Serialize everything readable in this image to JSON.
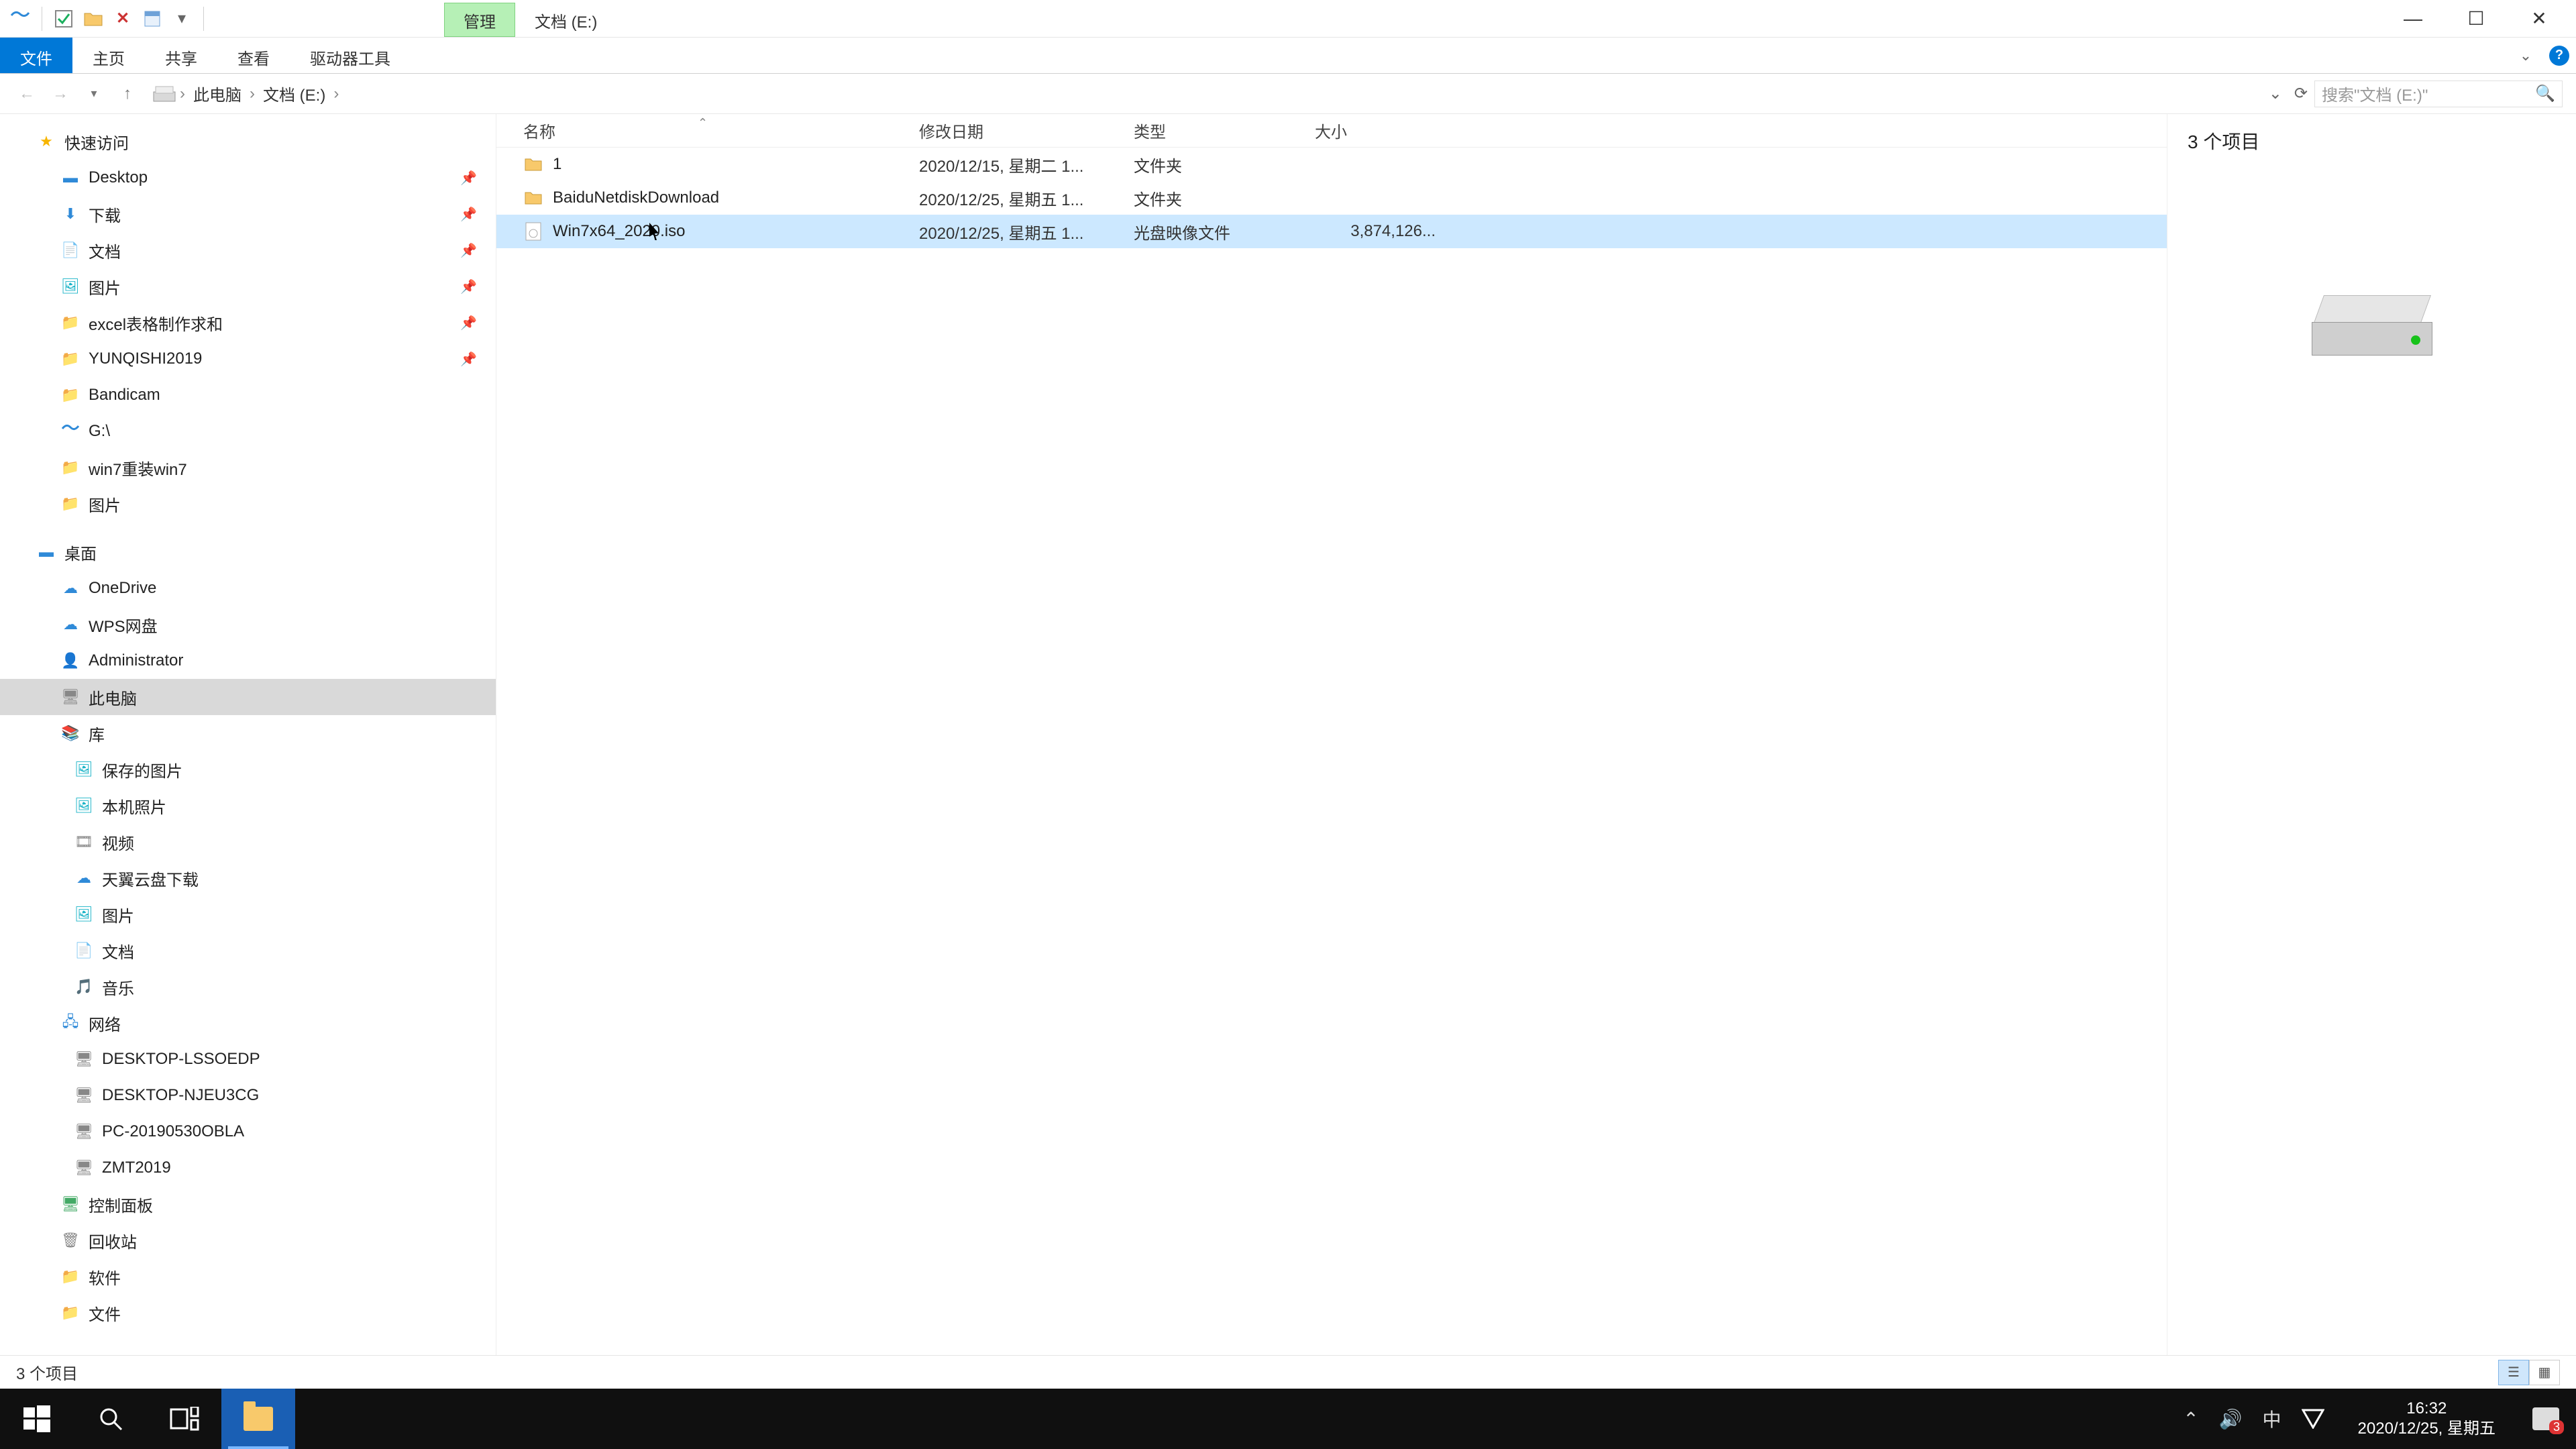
{
  "title_tab_context": "管理",
  "title_tab_location": "文档 (E:)",
  "ribbon": {
    "file": "文件",
    "home": "主页",
    "share": "共享",
    "view": "查看",
    "drive_tools": "驱动器工具"
  },
  "breadcrumb": {
    "pc": "此电脑",
    "drive": "文档 (E:)"
  },
  "search_placeholder": "搜索\"文档 (E:)\"",
  "columns": {
    "name": "名称",
    "date": "修改日期",
    "type": "类型",
    "size": "大小"
  },
  "rows": [
    {
      "name": "1",
      "date": "2020/12/15, 星期二 1...",
      "type": "文件夹",
      "size": "",
      "icon": "folder",
      "selected": false
    },
    {
      "name": "BaiduNetdiskDownload",
      "date": "2020/12/25, 星期五 1...",
      "type": "文件夹",
      "size": "",
      "icon": "folder",
      "selected": false
    },
    {
      "name": "Win7x64_2020.iso",
      "date": "2020/12/25, 星期五 1...",
      "type": "光盘映像文件",
      "size": "3,874,126...",
      "icon": "iso",
      "selected": true
    }
  ],
  "nav": {
    "quick": "快速访问",
    "quick_items": [
      "Desktop",
      "下载",
      "文档",
      "图片",
      "excel表格制作求和",
      "YUNQISHI2019",
      "Bandicam",
      "G:\\",
      "win7重装win7",
      "图片"
    ],
    "desktop": "桌面",
    "desktop_items": [
      "OneDrive",
      "WPS网盘",
      "Administrator",
      "此电脑",
      "库"
    ],
    "lib_items": [
      "保存的图片",
      "本机照片",
      "视频",
      "天翼云盘下载",
      "图片",
      "文档",
      "音乐"
    ],
    "network": "网络",
    "net_items": [
      "DESKTOP-LSSOEDP",
      "DESKTOP-NJEU3CG",
      "PC-20190530OBLA",
      "ZMT2019"
    ],
    "control_panel": "控制面板",
    "recycle": "回收站",
    "soft": "软件",
    "docs": "文件"
  },
  "preview_count": "3 个项目",
  "status_text": "3 个项目",
  "clock": {
    "time": "16:32",
    "date": "2020/12/25, 星期五"
  },
  "ime": "中",
  "notif_badge": "3"
}
